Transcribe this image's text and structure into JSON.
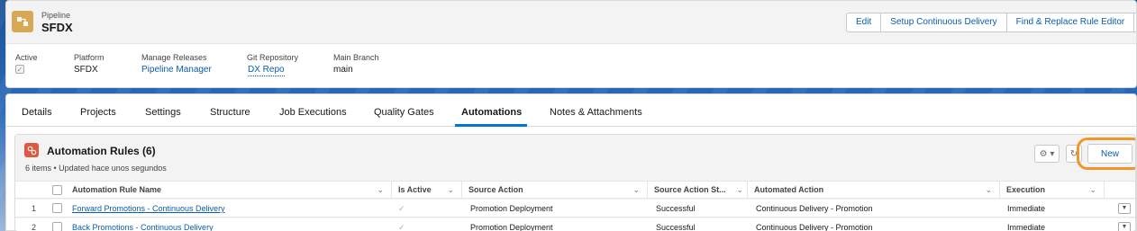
{
  "header": {
    "eyebrow": "Pipeline",
    "title": "SFDX",
    "buttons": {
      "edit": "Edit",
      "setup_cd": "Setup Continuous Delivery",
      "find_replace": "Find & Replace Rule Editor",
      "more": "▼"
    },
    "fields": [
      {
        "label": "Active",
        "value": "✓"
      },
      {
        "label": "Platform",
        "value": "SFDX"
      },
      {
        "label": "Manage Releases",
        "value": "Pipeline Manager"
      },
      {
        "label": "Git Repository",
        "value": "DX Repo"
      },
      {
        "label": "Main Branch",
        "value": "main"
      }
    ]
  },
  "tabs": [
    {
      "label": "Details"
    },
    {
      "label": "Projects"
    },
    {
      "label": "Settings"
    },
    {
      "label": "Structure"
    },
    {
      "label": "Job Executions"
    },
    {
      "label": "Quality Gates"
    },
    {
      "label": "Automations",
      "active": true
    },
    {
      "label": "Notes & Attachments"
    }
  ],
  "related": {
    "title": "Automation Rules (6)",
    "subtitle": "6 items • Updated hace unos segundos",
    "new_label": "New",
    "gear_label": "⚙ ▾",
    "refresh_label": "↻"
  },
  "table": {
    "columns": {
      "name": "Automation Rule Name",
      "active": "Is Active",
      "source": "Source Action",
      "status": "Source Action St...",
      "automated": "Automated Action",
      "execution": "Execution"
    },
    "rows": [
      {
        "num": "1",
        "name": "Forward Promotions - Continuous Delivery",
        "active": "✓",
        "source": "Promotion Deployment",
        "status": "Successful",
        "automated": "Continuous Delivery - Promotion",
        "execution": "Immediate"
      },
      {
        "num": "2",
        "name": "Back Promotions - Continuous Delivery",
        "active": "✓",
        "source": "Promotion Deployment",
        "status": "Successful",
        "automated": "Continuous Delivery - Promotion",
        "execution": "Immediate"
      }
    ]
  },
  "colors": {
    "brand_blue": "#0b5cab",
    "active_tab": "#0176d3",
    "highlight": "#f0962a",
    "pipeline_icon": "#d8a955",
    "automation_icon": "#e3573f"
  }
}
